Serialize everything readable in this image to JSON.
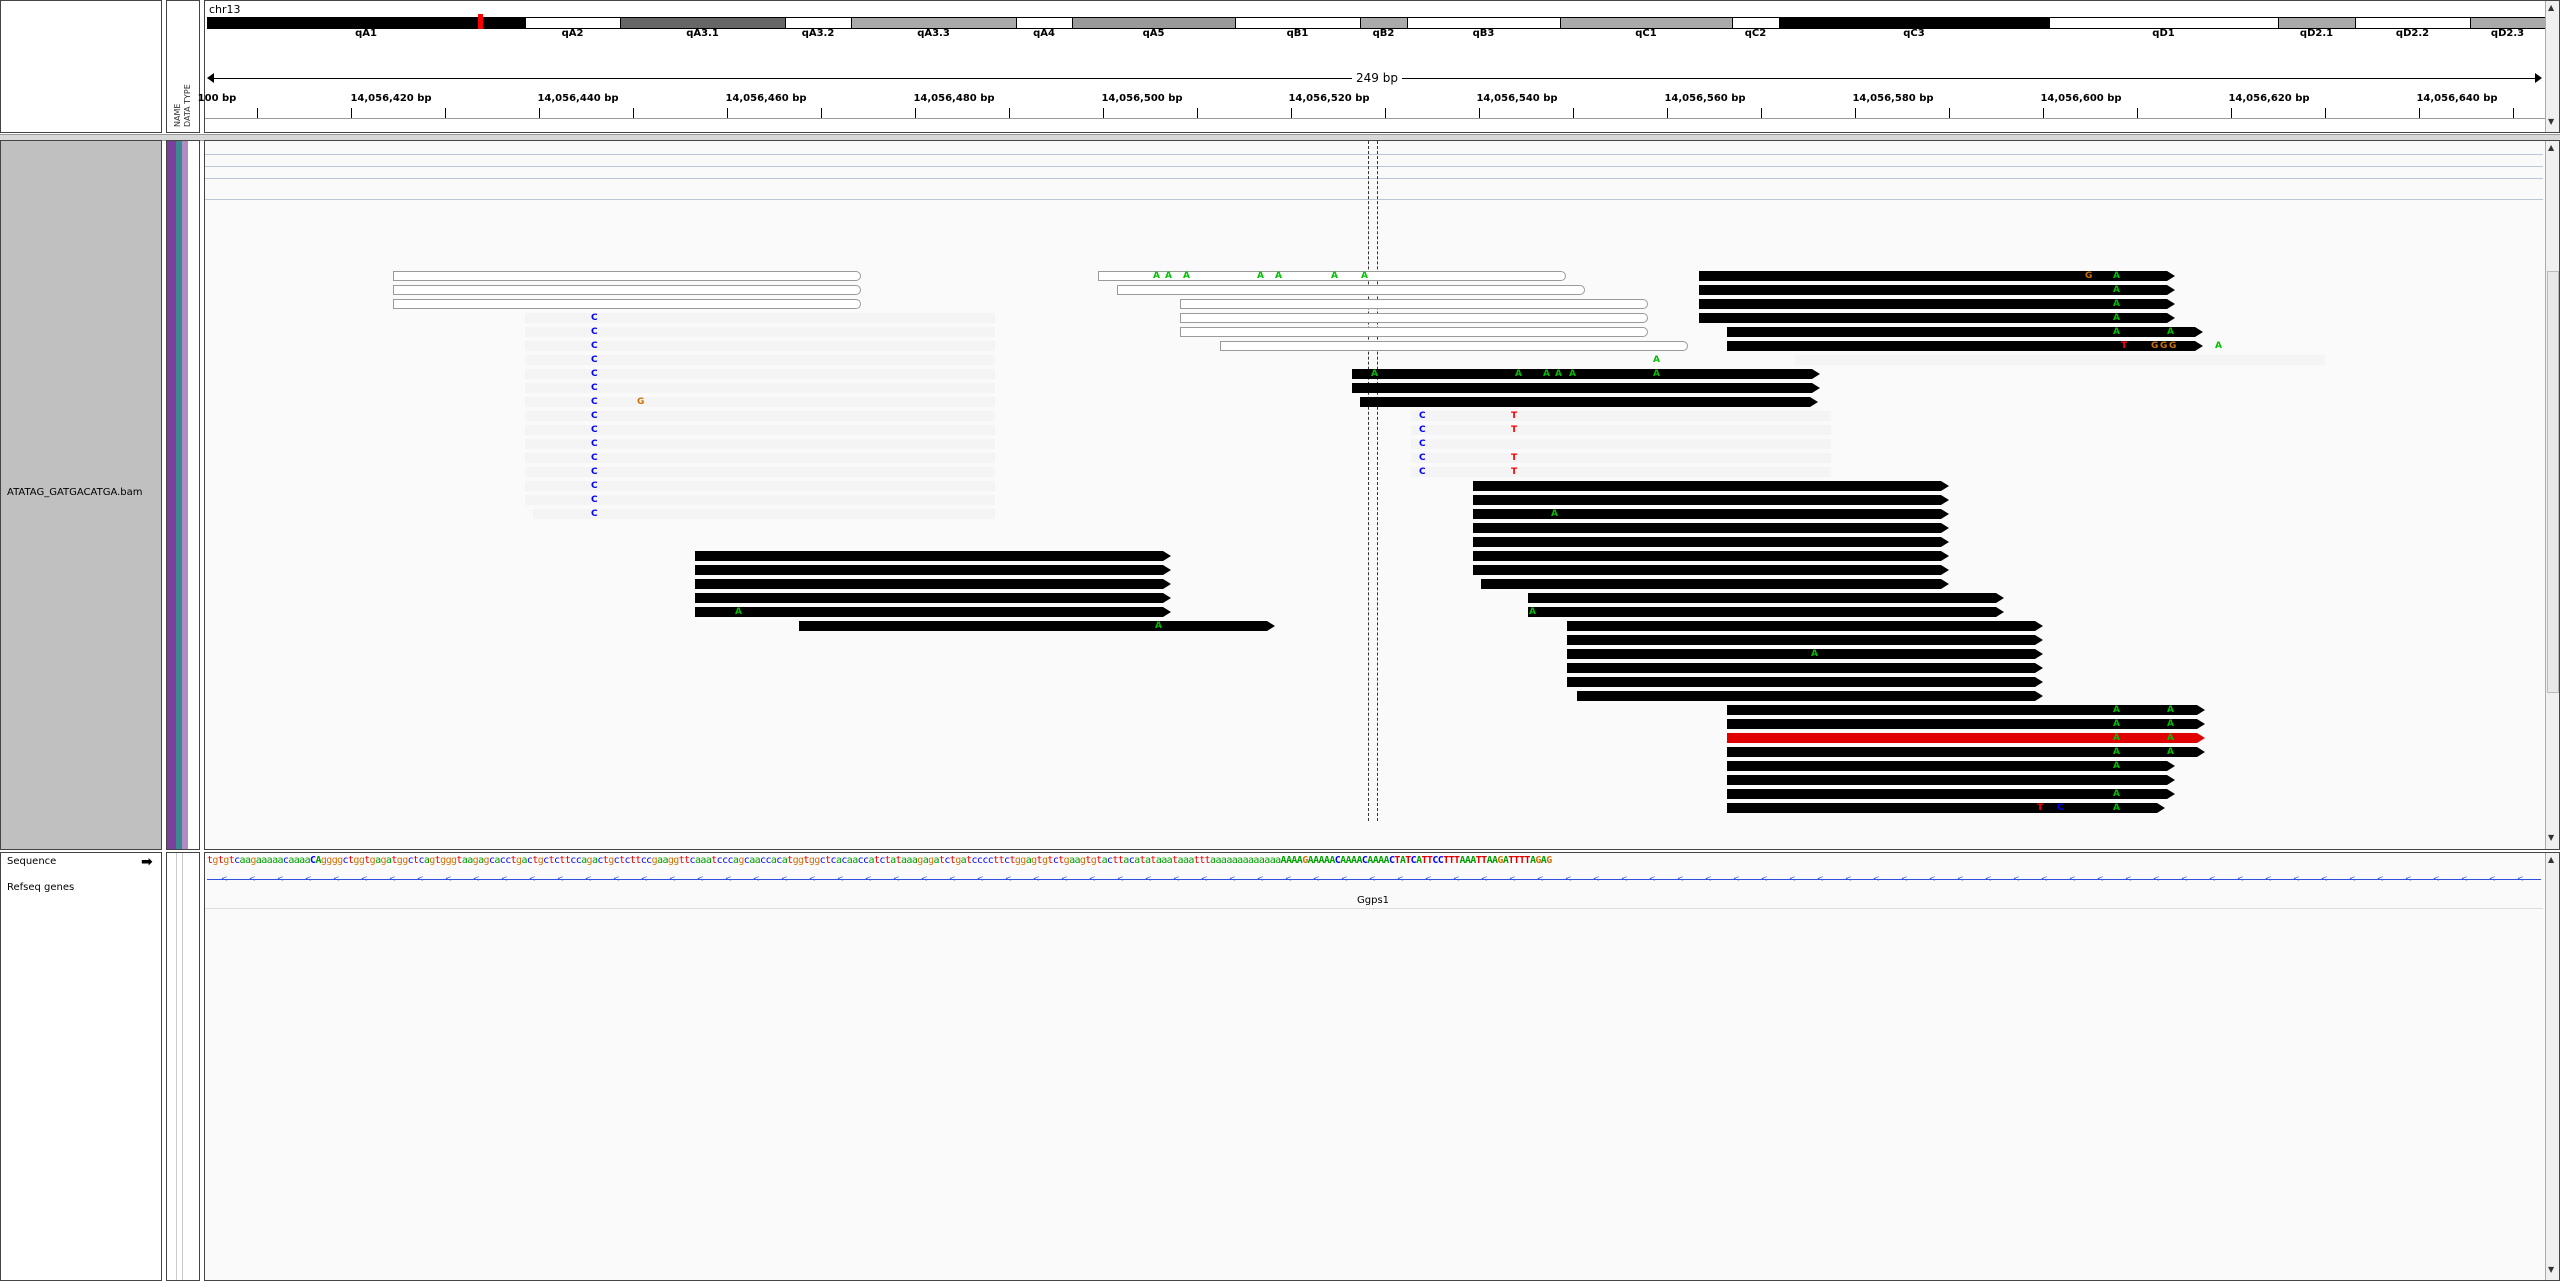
{
  "chromosome": "chr13",
  "cytobands": [
    {
      "name": "qA1",
      "color": "#000000"
    },
    {
      "name": "qA2",
      "color": "#ffffff"
    },
    {
      "name": "qA3.1",
      "color": "#666666"
    },
    {
      "name": "qA3.2",
      "color": "#ffffff"
    },
    {
      "name": "qA3.3",
      "color": "#aaaaaa"
    },
    {
      "name": "qA4",
      "color": "#ffffff"
    },
    {
      "name": "qA5",
      "color": "#999999"
    },
    {
      "name": "qB1",
      "color": "#ffffff"
    },
    {
      "name": "qB2",
      "color": "#aaaaaa"
    },
    {
      "name": "qB3",
      "color": "#ffffff"
    },
    {
      "name": "qC1",
      "color": "#aaaaaa"
    },
    {
      "name": "qC2",
      "color": "#ffffff"
    },
    {
      "name": "qC3",
      "color": "#000000"
    },
    {
      "name": "qD1",
      "color": "#ffffff"
    },
    {
      "name": "qD2.1",
      "color": "#aaaaaa"
    },
    {
      "name": "qD2.2",
      "color": "#ffffff"
    },
    {
      "name": "qD2.3",
      "color": "#aaaaaa"
    }
  ],
  "ruler": {
    "span_label": "249 bp",
    "ticks": [
      "100 bp",
      "14,056,420 bp",
      "14,056,440 bp",
      "14,056,460 bp",
      "14,056,480 bp",
      "14,056,500 bp",
      "14,056,520 bp",
      "14,056,540 bp",
      "14,056,560 bp",
      "14,056,580 bp",
      "14,056,600 bp",
      "14,056,620 bp",
      "14,056,640 bp"
    ]
  },
  "attribute_header": {
    "col1": "NAME",
    "col2": "DATA TYPE"
  },
  "tracks": {
    "alignment": "ATATAG_GATGACATGA.bam",
    "sequence": "Sequence",
    "genes": "Refseq genes",
    "gene_name": "Ggps1"
  },
  "sequence_text": "tgtgtcaagaaaaacaaaaCAggggctggtgagatggctcagtgggtaagagcacctgactgctcttccagactgctcttccgaaggttcaaatcccagcaaccacatggtggctcacaaccatctataaagagatctgatccccttctggagtgtctgaagtgtacttacatataaataaatttaaaaaaaaaaaaaAAAAGAAAAACAAAACAAAACTATCATTCCTTTAAATTAAGATTTTAGAG",
  "colors": {
    "A": "#00c000",
    "C": "#0000ff",
    "G": "#d17105",
    "T": "#ff0000",
    "ideogram_marker": "#ff0000",
    "sample_bar_1": "#7b3f9e",
    "sample_bar_2": "#3c8a8f"
  }
}
